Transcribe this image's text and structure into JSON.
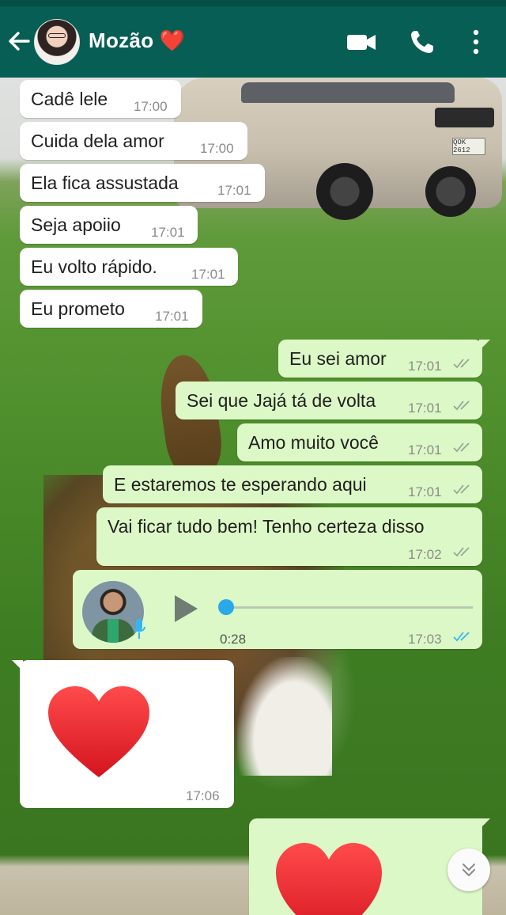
{
  "header": {
    "back_icon": "arrow-left-icon",
    "contact_name": "Mozão",
    "contact_emoji": "❤️",
    "actions": [
      "video-call-icon",
      "phone-icon",
      "more-vert-icon"
    ]
  },
  "messages": [
    {
      "direction": "in",
      "text": "Cadê lele",
      "time": "17:00"
    },
    {
      "direction": "in",
      "text": "Cuida dela amor",
      "time": "17:00"
    },
    {
      "direction": "in",
      "text": "Ela fica assustada",
      "time": "17:01"
    },
    {
      "direction": "in",
      "text": "Seja apoiio",
      "time": "17:01"
    },
    {
      "direction": "in",
      "text": "Eu volto rápido.",
      "time": "17:01"
    },
    {
      "direction": "in",
      "text": "Eu prometo",
      "time": "17:01"
    },
    {
      "direction": "out",
      "text": "Eu sei amor",
      "time": "17:01",
      "status": "read"
    },
    {
      "direction": "out",
      "text": "Sei que Jajá tá de volta",
      "time": "17:01",
      "status": "read"
    },
    {
      "direction": "out",
      "text": "Amo muito você",
      "time": "17:01",
      "status": "read"
    },
    {
      "direction": "out",
      "text": "E estaremos te esperando aqui",
      "time": "17:01",
      "status": "read"
    },
    {
      "direction": "out",
      "text": "Vai ficar tudo bem! Tenho certeza disso",
      "time": "17:02",
      "status": "read"
    },
    {
      "direction": "out",
      "type": "voice",
      "duration": "0:28",
      "time": "17:03",
      "status": "read-blue",
      "progress": 0
    },
    {
      "direction": "in",
      "type": "emoji",
      "emoji": "red-heart",
      "time": "17:06"
    },
    {
      "direction": "out",
      "type": "emoji",
      "emoji": "red-heart"
    }
  ],
  "scroll_button": "double-chevron-down-icon",
  "colors": {
    "header": "#075e54",
    "incoming_bubble": "#ffffff",
    "outgoing_bubble": "#dcf8c6",
    "read_ticks_blue": "#34b7f1",
    "ticks_grey": "#9aa59a",
    "heart": "#e8232e"
  }
}
